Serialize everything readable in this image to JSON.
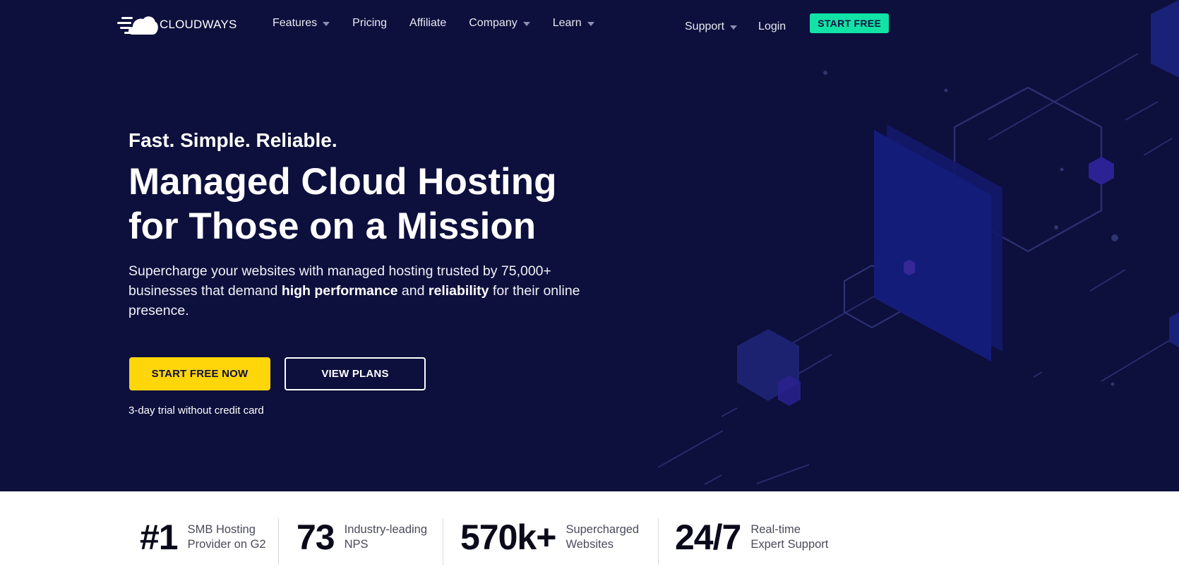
{
  "brand": {
    "name": "CLOUDWAYS"
  },
  "nav": {
    "items": [
      {
        "label": "Features",
        "dropdown": true
      },
      {
        "label": "Pricing",
        "dropdown": false
      },
      {
        "label": "Affiliate",
        "dropdown": false
      },
      {
        "label": "Company",
        "dropdown": true
      },
      {
        "label": "Learn",
        "dropdown": true
      }
    ],
    "support_label": "Support",
    "login_label": "Login",
    "cta_label": "START FREE"
  },
  "hero": {
    "tagline": "Fast. Simple. Reliable.",
    "headline_line1": "Managed Cloud Hosting",
    "headline_line2": "for Those on a Mission",
    "sub_part1": "Supercharge your websites with managed hosting trusted by 75,000+ businesses that demand ",
    "sub_bold1": "high performance",
    "sub_part2": " and ",
    "sub_bold2": "reliability",
    "sub_part3": " for their online presence.",
    "primary_cta": "START FREE NOW",
    "secondary_cta": "VIEW PLANS",
    "trial_note": "3-day trial without credit card"
  },
  "stats": [
    {
      "value": "#1",
      "label": "SMB Hosting Provider on G2"
    },
    {
      "value": "73",
      "label": "Industry-leading NPS"
    },
    {
      "value": "570k+",
      "label": "Supercharged Websites"
    },
    {
      "value": "24/7",
      "label": "Real-time Expert Support"
    }
  ],
  "colors": {
    "hero_bg": "#0d0f3c",
    "accent_green": "#11e3a6",
    "accent_yellow": "#ffd60a"
  }
}
